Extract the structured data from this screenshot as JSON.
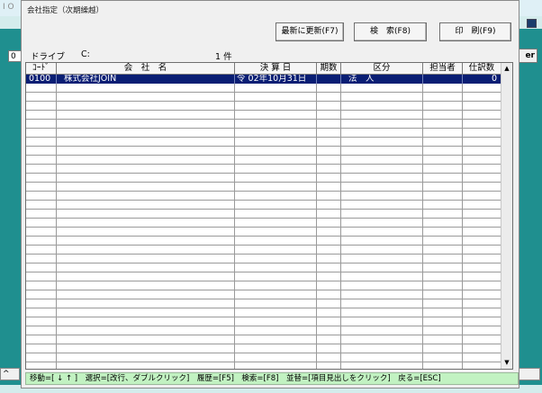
{
  "background": {
    "title": "I O",
    "left_field": "0",
    "right_button": "er",
    "left_bottom": "^"
  },
  "dialog": {
    "title": "会社指定（次期繰越）",
    "buttons": {
      "refresh": "最新に更新(F7)",
      "search": "検　索(F8)",
      "print": "印　刷(F9)"
    },
    "drive_label": "ドライブ",
    "drive_value": "C:",
    "count": "1 件"
  },
  "grid": {
    "headers": [
      "ｺｰﾄﾞ",
      "会　社　名",
      "決 算 日",
      "期数",
      "区分",
      "担当者",
      "仕訳数"
    ],
    "rows": [
      {
        "code": "0100",
        "name": "株式会社JOIN",
        "closing_date": "令 02年10月31日",
        "period": "",
        "category": "法　人",
        "person": "",
        "entries": "0"
      }
    ],
    "selected_row_color": "#0a1e74"
  },
  "status_bar": {
    "text": "移動=[ ↓ ↑ ]　選択=[改行、ダブルクリック]　履歴=[F5]　検索=[F8]　並替=[項目見出しをクリック]　戻る=[ESC]"
  },
  "icons": {
    "scroll_up": "▲",
    "scroll_down": "▼"
  }
}
